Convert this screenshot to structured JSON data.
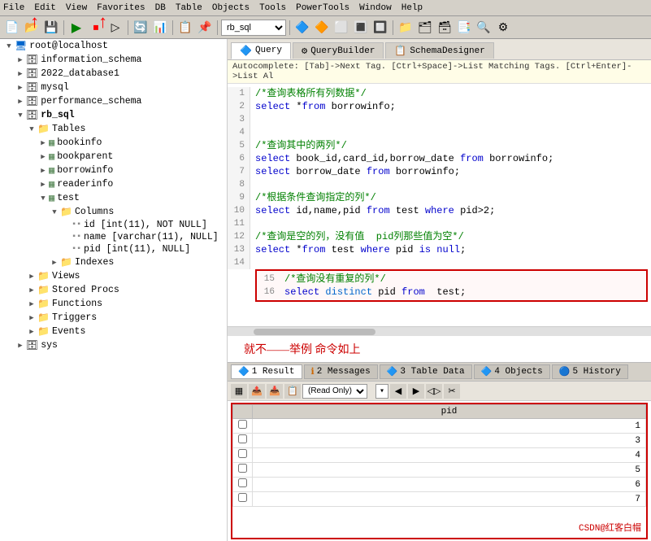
{
  "menubar": {
    "items": [
      "File",
      "Edit",
      "View",
      "Favorites",
      "DB",
      "Table",
      "Objects",
      "Tools",
      "PowerTools",
      "Window",
      "Help"
    ]
  },
  "toolbar": {
    "dropdown_value": "rb_sql",
    "red_arrow_label": "↑"
  },
  "query_tabs": [
    {
      "label": "Query",
      "icon": "🔷",
      "active": true
    },
    {
      "label": "QueryBuilder",
      "icon": "⚙",
      "active": false
    },
    {
      "label": "SchemaDesigner",
      "icon": "📋",
      "active": false
    }
  ],
  "autocomplete": {
    "text": "Autocomplete: [Tab]->Next Tag. [Ctrl+Space]->List Matching Tags. [Ctrl+Enter]->List Al"
  },
  "code_lines": [
    {
      "num": 1,
      "text": "/*查询表格所有列数据*/",
      "type": "comment"
    },
    {
      "num": 2,
      "text": "select *from borrowinfo;",
      "type": "sql"
    },
    {
      "num": 3,
      "text": "",
      "type": "empty"
    },
    {
      "num": 4,
      "text": "",
      "type": "empty"
    },
    {
      "num": 5,
      "text": "/*查询其中的两列*/",
      "type": "comment"
    },
    {
      "num": 6,
      "text": "select book_id,card_id,borrow_date from borrowinfo;",
      "type": "sql"
    },
    {
      "num": 7,
      "text": "select borrow_date from borrowinfo;",
      "type": "sql"
    },
    {
      "num": 8,
      "text": "",
      "type": "empty"
    },
    {
      "num": 9,
      "text": "/*根据条件查询指定的列*/",
      "type": "comment"
    },
    {
      "num": 10,
      "text": "select id,name,pid from test where pid>2;",
      "type": "sql"
    },
    {
      "num": 11,
      "text": "",
      "type": "empty"
    },
    {
      "num": 12,
      "text": "/*查询是空的列，没有值  pid列那些值为空*/",
      "type": "comment"
    },
    {
      "num": 13,
      "text": "select *from test where pid is null;",
      "type": "sql"
    },
    {
      "num": 14,
      "text": "",
      "type": "empty"
    },
    {
      "num": 15,
      "text": "/*查询没有重复的列*/",
      "type": "comment",
      "highlight": true
    },
    {
      "num": 16,
      "text": "select distinct pid from  test;",
      "type": "sql",
      "highlight": true
    }
  ],
  "annotation": "就不——举例  命令如上",
  "bottom_tabs": [
    {
      "num": "1",
      "label": "Result",
      "icon": "🔷",
      "active": true
    },
    {
      "num": "2",
      "label": "Messages",
      "icon": "ℹ",
      "warn": true
    },
    {
      "num": "3",
      "label": "Table Data",
      "icon": "🔷"
    },
    {
      "num": "4",
      "label": "Objects",
      "icon": "🔷"
    },
    {
      "num": "5",
      "label": "History",
      "icon": "🔵"
    }
  ],
  "result_toolbar": {
    "readonly_label": "(Read Only)"
  },
  "result_table": {
    "header": [
      "pid"
    ],
    "rows": [
      {
        "pid": "1"
      },
      {
        "pid": "3"
      },
      {
        "pid": "4"
      },
      {
        "pid": "5"
      },
      {
        "pid": "6"
      },
      {
        "pid": "7"
      }
    ]
  },
  "sidebar": {
    "items": [
      {
        "label": "root@localhost",
        "icon": "🖥",
        "level": 0,
        "expanded": true
      },
      {
        "label": "information_schema",
        "icon": "🗄",
        "level": 1,
        "expanded": false
      },
      {
        "label": "2022_database1",
        "icon": "🗄",
        "level": 1,
        "expanded": false
      },
      {
        "label": "mysql",
        "icon": "🗄",
        "level": 1,
        "expanded": false
      },
      {
        "label": "performance_schema",
        "icon": "🗄",
        "level": 1,
        "expanded": false
      },
      {
        "label": "rb_sql",
        "icon": "🗄",
        "level": 1,
        "expanded": true
      },
      {
        "label": "Tables",
        "icon": "📁",
        "level": 2,
        "expanded": true
      },
      {
        "label": "bookinfo",
        "icon": "🗃",
        "level": 3
      },
      {
        "label": "bookparent",
        "icon": "🗃",
        "level": 3
      },
      {
        "label": "borrowinfo",
        "icon": "🗃",
        "level": 3
      },
      {
        "label": "readerinfo",
        "icon": "🗃",
        "level": 3
      },
      {
        "label": "test",
        "icon": "🗃",
        "level": 3,
        "expanded": true
      },
      {
        "label": "Columns",
        "icon": "📁",
        "level": 4,
        "expanded": true
      },
      {
        "label": "id [int(11), NOT NULL]",
        "icon": "▪",
        "level": 5
      },
      {
        "label": "name [varchar(11), NULL]",
        "icon": "▪",
        "level": 5
      },
      {
        "label": "pid [int(11), NULL]",
        "icon": "▪",
        "level": 5
      },
      {
        "label": "Indexes",
        "icon": "📁",
        "level": 4
      },
      {
        "label": "Views",
        "icon": "📁",
        "level": 2
      },
      {
        "label": "Stored Procs",
        "icon": "📁",
        "level": 2
      },
      {
        "label": "Functions",
        "icon": "📁",
        "level": 2
      },
      {
        "label": "Triggers",
        "icon": "📁",
        "level": 2
      },
      {
        "label": "Events",
        "icon": "📁",
        "level": 2
      },
      {
        "label": "sys",
        "icon": "🗄",
        "level": 1
      }
    ]
  },
  "watermark": "CSDN@红客白帽"
}
